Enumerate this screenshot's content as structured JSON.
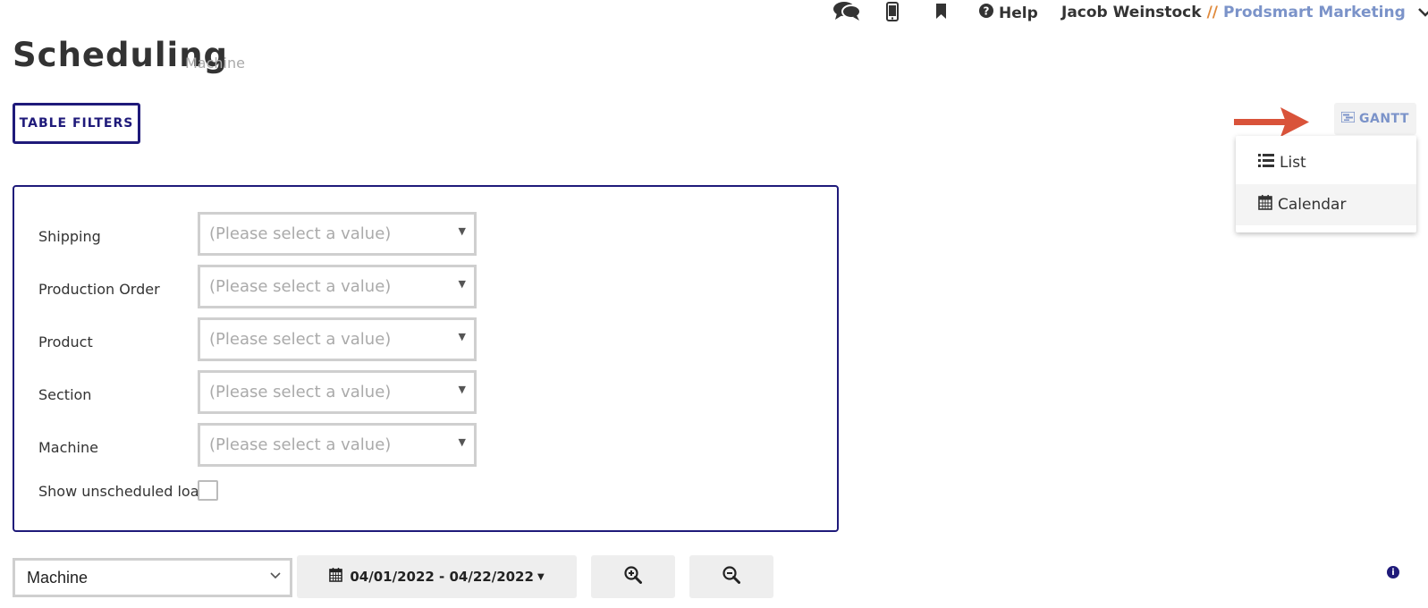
{
  "header": {
    "icons": [
      "chat-icon",
      "mobile-icon",
      "bookmark-icon"
    ],
    "help_label": "Help",
    "user_name": "Jacob Weinstock",
    "separator": "//",
    "company": "Prodsmart Marketing"
  },
  "page": {
    "title": "Scheduling",
    "subtitle": "Machine"
  },
  "toolbar": {
    "table_filters_label": "TABLE FILTERS",
    "gantt_label": "GANTT"
  },
  "view_menu": {
    "items": [
      {
        "label": "List",
        "icon": "list-icon"
      },
      {
        "label": "Calendar",
        "icon": "calendar-icon"
      }
    ]
  },
  "filters": {
    "fields": [
      {
        "label": "Shipping",
        "placeholder": "(Please select a value)"
      },
      {
        "label": "Production Order",
        "placeholder": "(Please select a value)"
      },
      {
        "label": "Product",
        "placeholder": "(Please select a value)"
      },
      {
        "label": "Section",
        "placeholder": "(Please select a value)"
      },
      {
        "label": "Machine",
        "placeholder": "(Please select a value)"
      }
    ],
    "unscheduled_label": "Show unscheduled load"
  },
  "controls": {
    "group_by_value": "Machine",
    "date_range": "04/01/2022 - 04/22/2022"
  },
  "colors": {
    "accent": "#1f1a7a",
    "link": "#7b93c9",
    "separator": "#e08a3c",
    "annotation_arrow": "#d9533a"
  }
}
